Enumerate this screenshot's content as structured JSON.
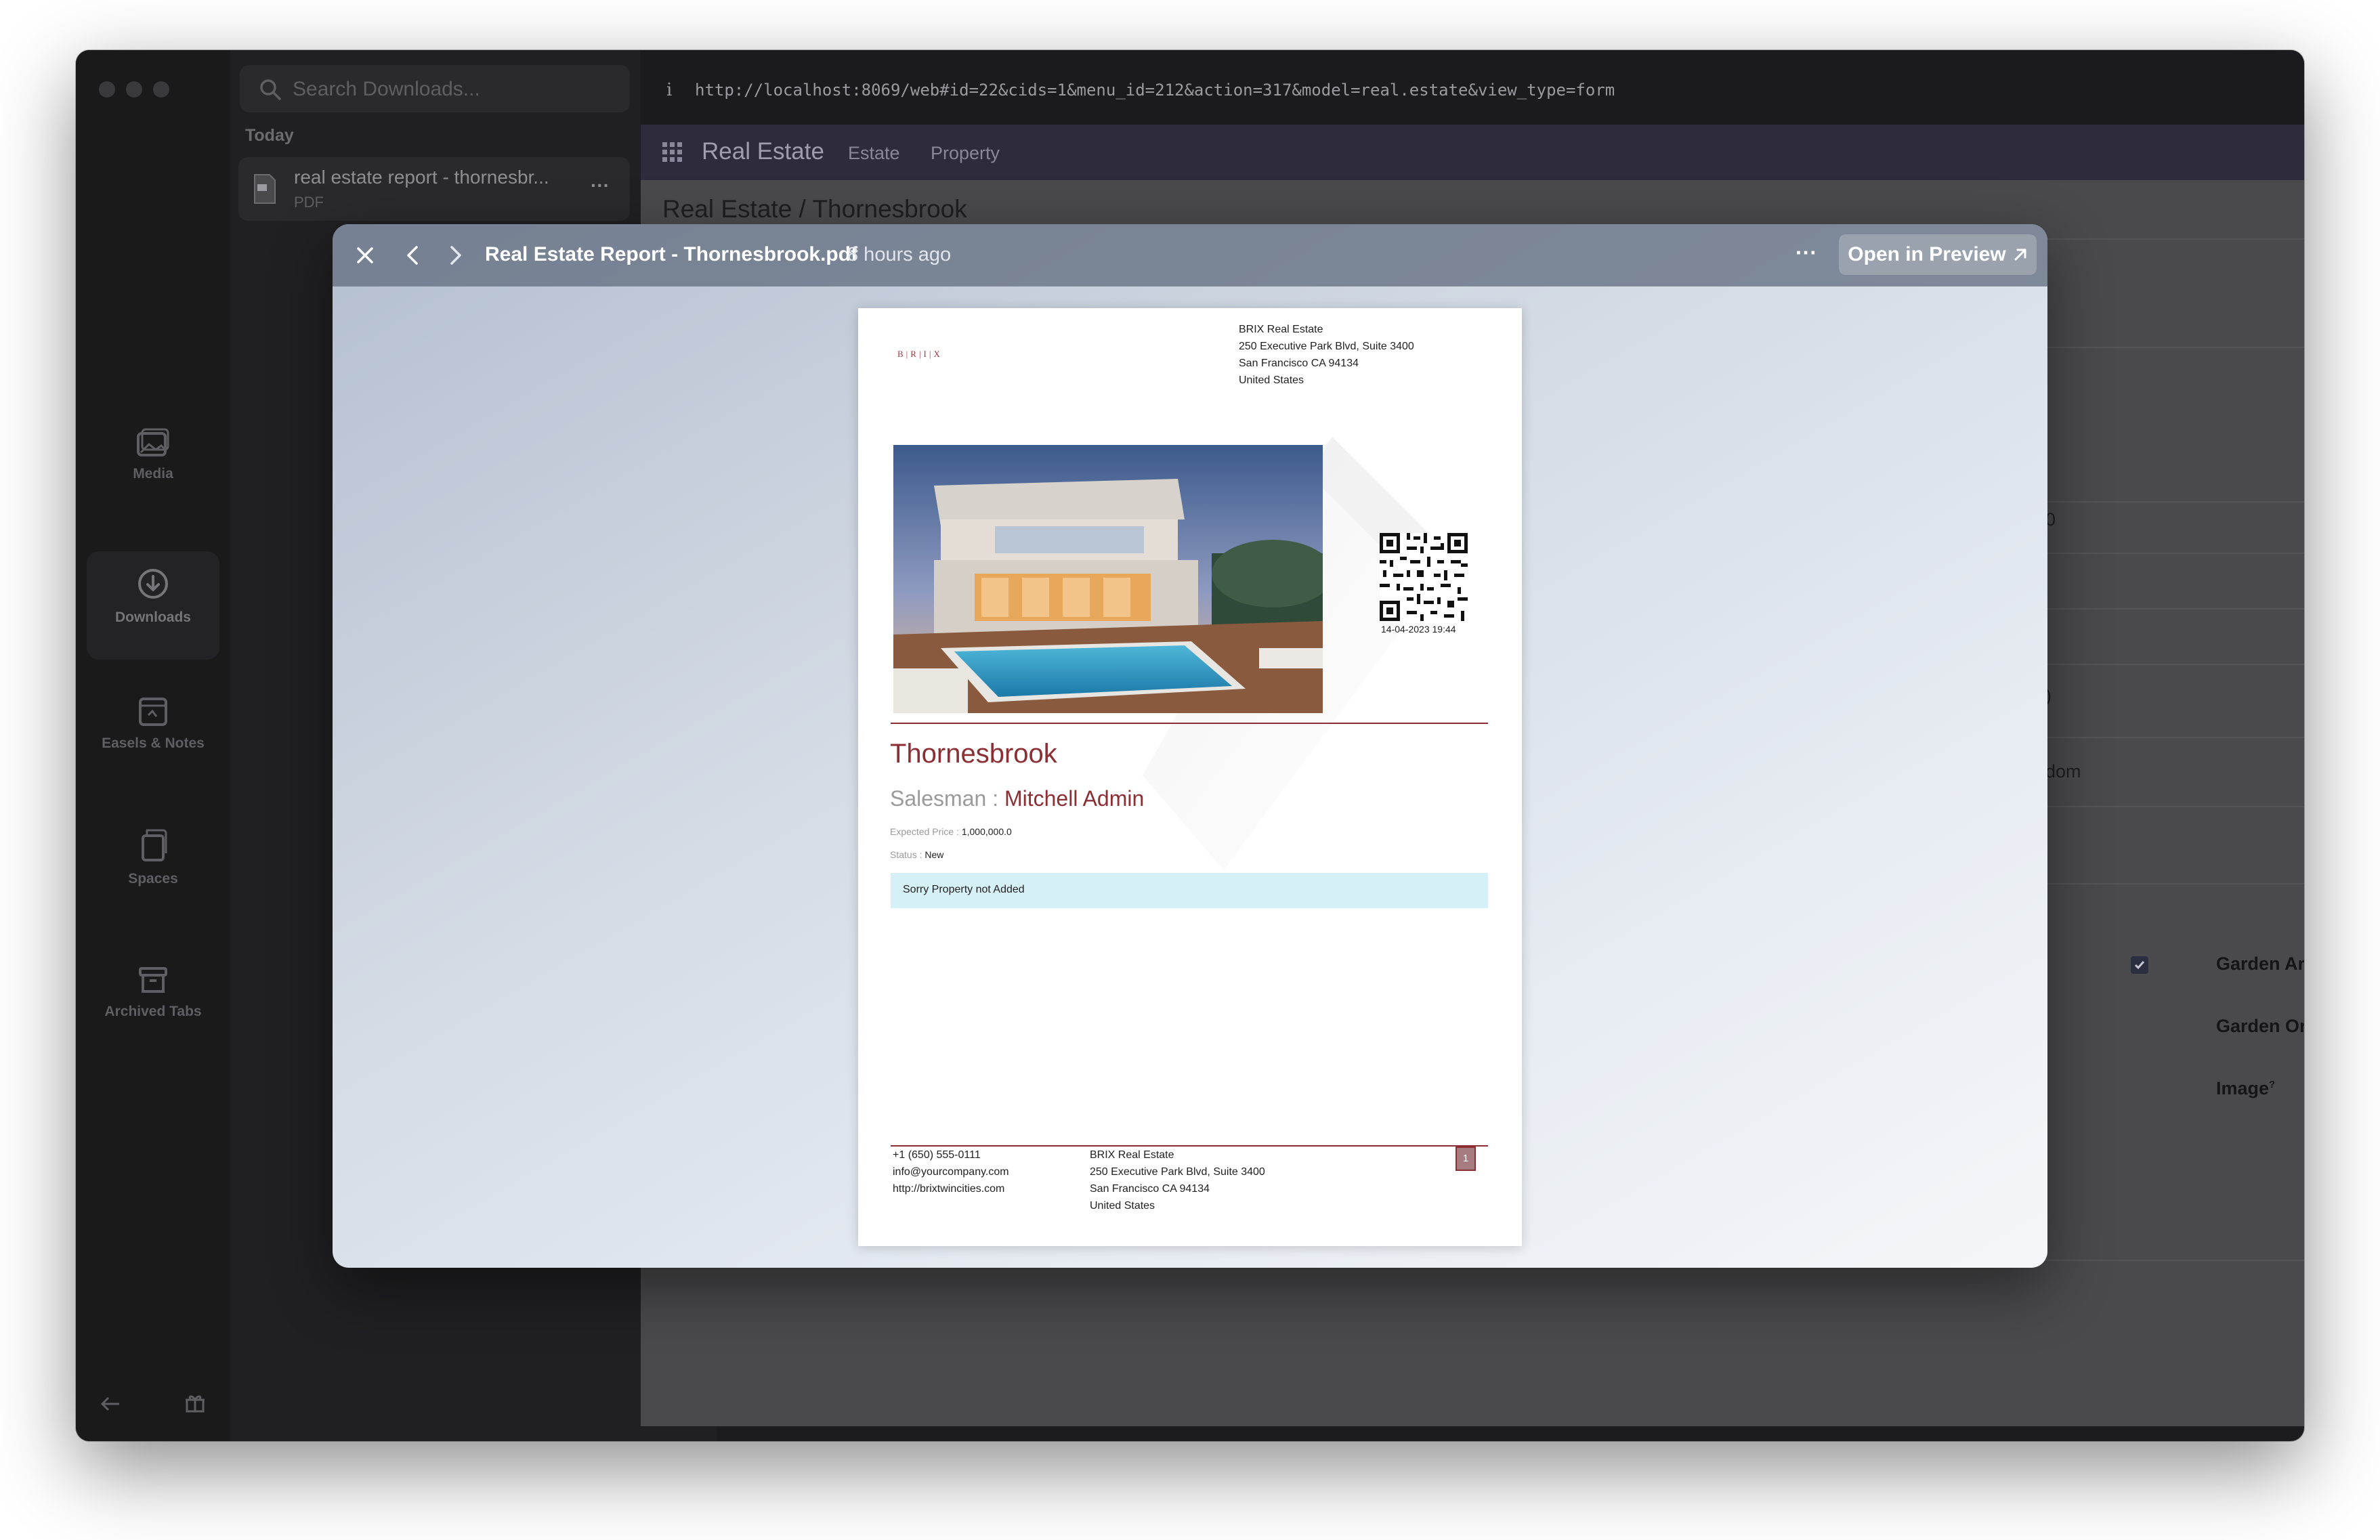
{
  "downloads": {
    "search_placeholder": "Search Downloads...",
    "section_label": "Today",
    "item": {
      "name": "real estate report - thornesbr...",
      "type": "PDF"
    }
  },
  "rail": {
    "items": [
      {
        "label": "Media",
        "icon": "media-icon"
      },
      {
        "label": "Downloads",
        "icon": "downloads-icon",
        "active": true
      },
      {
        "label": "Easels & Notes",
        "icon": "easel-icon"
      },
      {
        "label": "Spaces",
        "icon": "spaces-icon"
      },
      {
        "label": "Archived Tabs",
        "icon": "archive-icon"
      }
    ]
  },
  "browser": {
    "url": "http://localhost:8069/web#id=22&cids=1&menu_id=212&action=317&model=real.estate&view_type=form",
    "info_glyph": "i",
    "app_title": "Real Estate",
    "nav": [
      "Estate",
      "Property"
    ],
    "breadcrumb": "Real Estate / Thornesbrook",
    "fields": [
      "Garden Area",
      "Garden Orientation",
      "Image"
    ],
    "field_help_mark": "?",
    "partial_values": [
      "0",
      ")",
      "dom"
    ]
  },
  "quicklook": {
    "title": "Real Estate Report - Thornesbrook.pdf",
    "time": "8 hours ago",
    "open_button": "Open in Preview"
  },
  "pdf": {
    "logo": "B|R|I|X",
    "company_address": [
      "BRIX Real Estate",
      "250 Executive Park Blvd, Suite 3400",
      "San Francisco CA 94134",
      "United States"
    ],
    "qr_date": "14-04-2023 19:44",
    "property_name": "Thornesbrook",
    "salesman_label": "Salesman :",
    "salesman": "Mitchell Admin",
    "expected_price_label": "Expected Price :",
    "expected_price": "1,000,000.0",
    "status_label": "Status :",
    "status": "New",
    "alert": "Sorry Property not Added",
    "footer_contact": [
      "+1 (650) 555-0111",
      "info@yourcompany.com",
      "http://brixtwincities.com"
    ],
    "footer_address": [
      "BRIX Real Estate",
      "250 Executive Park Blvd, Suite 3400",
      "San Francisco CA 94134",
      "United States"
    ],
    "page_number": "1"
  },
  "colors": {
    "accent_maroon": "#8b2f35",
    "odoo_nav": "#2e2b3c",
    "alert_bg": "#d6f0f7"
  }
}
